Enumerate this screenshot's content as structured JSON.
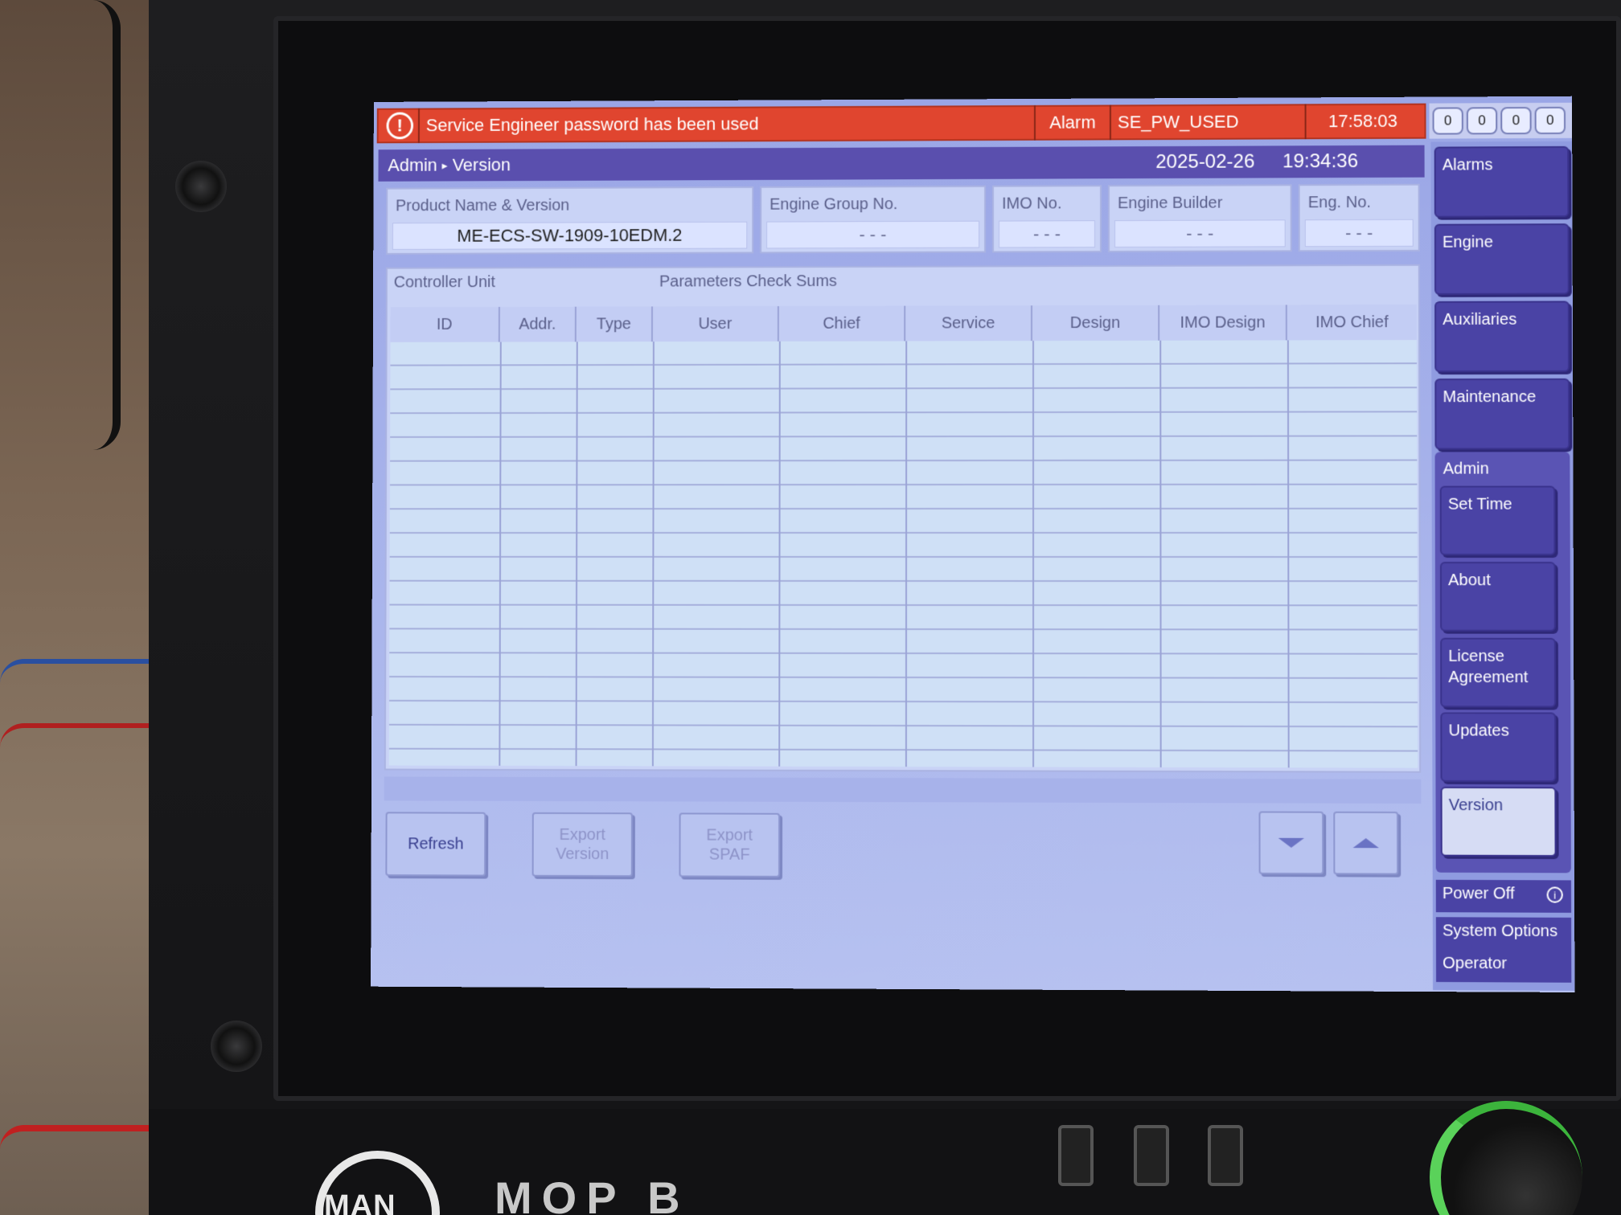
{
  "alarm": {
    "icon": "alarm-exclamation-icon",
    "message": "Service Engineer password has been used",
    "type": "Alarm",
    "code": "SE_PW_USED",
    "time": "17:58:03",
    "counters": [
      "0",
      "0",
      "0",
      "0"
    ]
  },
  "title_bar": {
    "crumb_root": "Admin",
    "crumb_page": "Version",
    "date": "2025-02-26",
    "time": "19:34:36"
  },
  "header_fields": {
    "product": {
      "label": "Product Name & Version",
      "value": "ME-ECS-SW-1909-10EDM.2"
    },
    "engine_group": {
      "label": "Engine Group No.",
      "value": "- - -"
    },
    "imo": {
      "label": "IMO No.",
      "value": "- - -"
    },
    "engine_builder": {
      "label": "Engine Builder",
      "value": "- - -"
    },
    "eng_no": {
      "label": "Eng. No.",
      "value": "- - -"
    }
  },
  "table": {
    "group_controller": "Controller Unit",
    "group_params": "Parameters Check Sums",
    "columns": [
      "ID",
      "Addr.",
      "Type",
      "User",
      "Chief",
      "Service",
      "Design",
      "IMO Design",
      "IMO Chief"
    ],
    "rows": []
  },
  "buttons": {
    "refresh": "Refresh",
    "export_version": "Export\nVersion",
    "export_spaf": "Export\nSPAF"
  },
  "nav": {
    "alarms": "Alarms",
    "engine": "Engine",
    "auxiliaries": "Auxiliaries",
    "maintenance": "Maintenance",
    "admin": "Admin",
    "set_time": "Set Time",
    "about": "About",
    "license": "License Agreement",
    "updates": "Updates",
    "version": "Version",
    "power_off": "Power Off",
    "system_options": "System Options",
    "operator": "Operator"
  },
  "hardware": {
    "brand": "MAN",
    "model": "MOP B"
  },
  "colors": {
    "alarm_red": "#e0452f",
    "title_purple": "#5a4fae",
    "nav_purple": "#4a43a5",
    "screen_bg": "#b6c1f0"
  }
}
